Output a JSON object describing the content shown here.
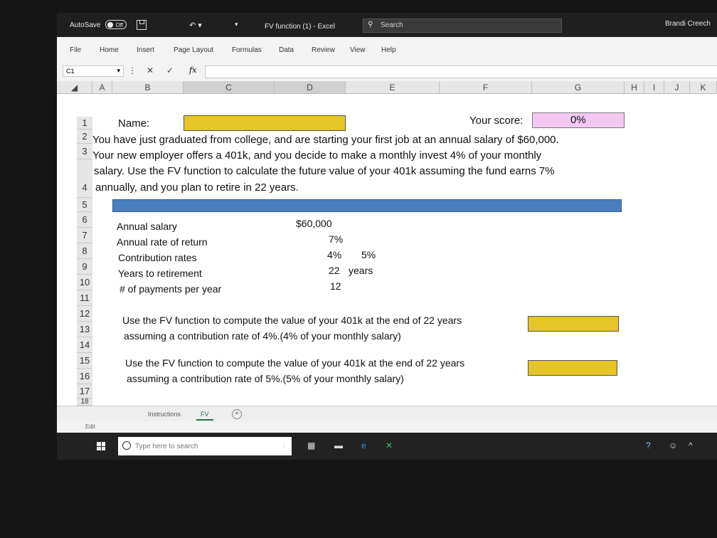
{
  "titlebar": {
    "autosave_label": "AutoSave",
    "autosave_state": "Off",
    "doc_title": "FV function (1)  -  Excel",
    "search_label": "Search",
    "user": "Brandi Creech"
  },
  "ribbon": {
    "tabs": [
      "File",
      "Home",
      "Insert",
      "Page Layout",
      "Formulas",
      "Data",
      "Review",
      "View",
      "Help"
    ]
  },
  "formula_bar": {
    "name_box": "C1",
    "fx": "fx",
    "value": ""
  },
  "columns": [
    "A",
    "B",
    "C",
    "D",
    "E",
    "F",
    "G",
    "H",
    "I",
    "J",
    "K"
  ],
  "rows": [
    "1",
    "2",
    "3",
    "4",
    "5",
    "6",
    "7",
    "8",
    "9",
    "10",
    "11",
    "12",
    "13",
    "14",
    "15",
    "16",
    "17",
    "18"
  ],
  "sheet": {
    "name_label": "Name:",
    "score_label": "Your score:",
    "score_value": "0%",
    "intro_lines": [
      "You have just graduated from college, and are starting your first job at an annual salary of $60,000.",
      "Your new employer offers a 401k, and you decide to make a monthly invest 4% of your monthly",
      "salary.  Use the FV function to calculate the future value of your 401k assuming the fund earns 7%",
      "annually, and you plan to retire in 22 years."
    ],
    "params": [
      {
        "label": "Annual salary",
        "value": "$60,000"
      },
      {
        "label": "Annual rate of return",
        "value": "7%"
      },
      {
        "label": "Contribution rates",
        "value": "4%",
        "value2": "5%"
      },
      {
        "label": "Years to retirement",
        "value": "22",
        "value2": "years"
      },
      {
        "label": "# of payments per year",
        "value": "12"
      }
    ],
    "question1": [
      "Use the FV function to compute the value of your 401k at the end of 22 years",
      "assuming a contribution rate of 4%.(4% of your monthly salary)"
    ],
    "question2": [
      "Use the FV function to compute the value of your 401k at the end of 22 years",
      "assuming a contribution rate of 5%.(5% of your monthly salary)"
    ]
  },
  "sheet_tabs": [
    "Instructions",
    "FV"
  ],
  "status": "Edit",
  "taskbar": {
    "search_placeholder": "Type here to search"
  },
  "colors": {
    "yellow_fill": "#e5c527",
    "pink_fill": "#f4c8f2",
    "blue_bar": "#4a7fc1"
  }
}
